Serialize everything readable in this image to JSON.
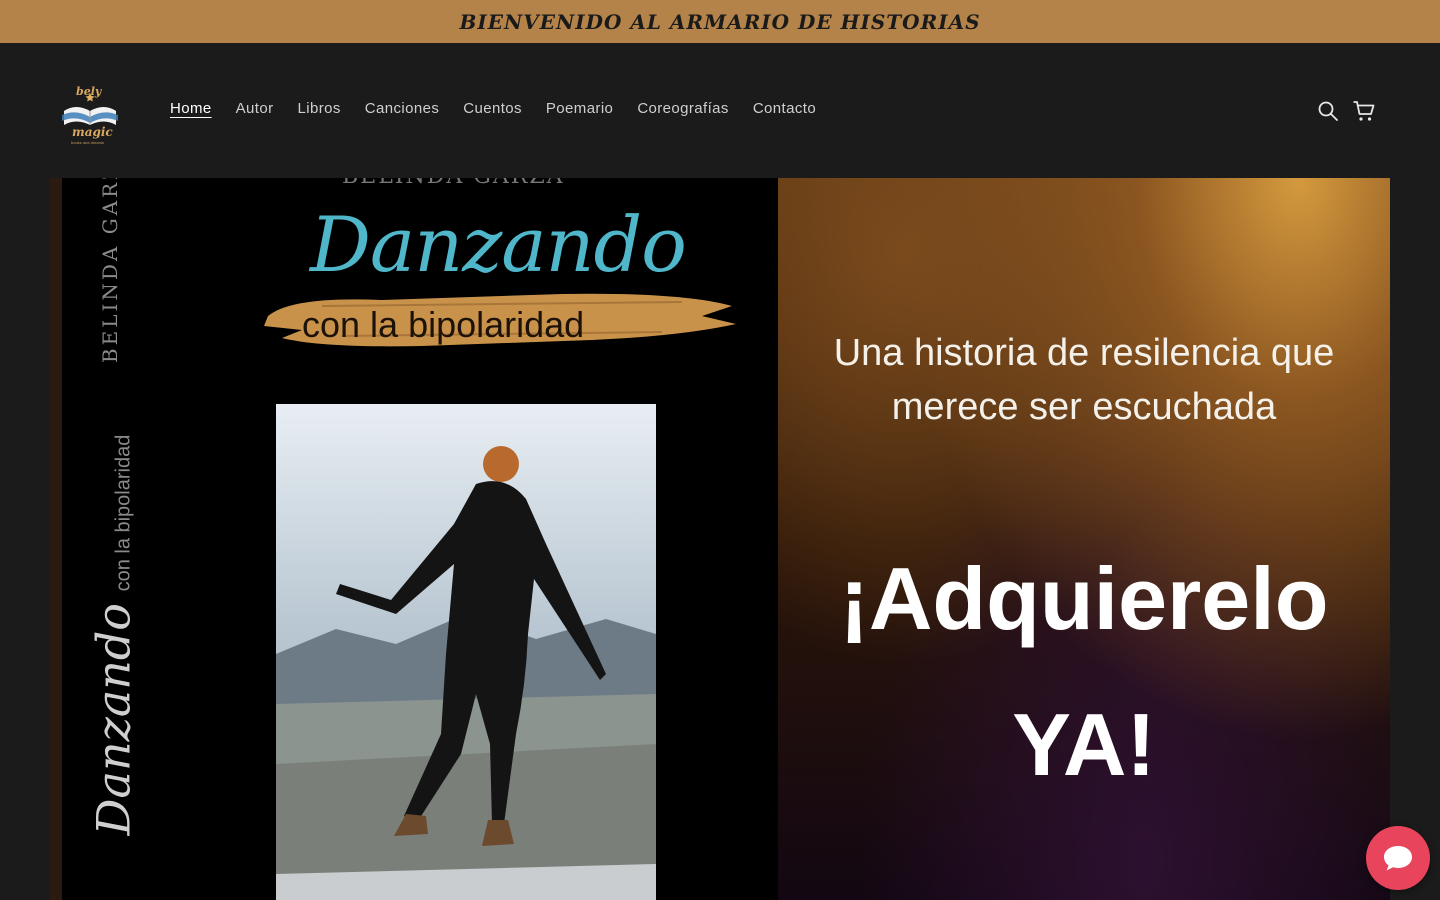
{
  "announcement": {
    "text": "BIENVENIDO AL ARMARIO DE HISTORIAS"
  },
  "header": {
    "logo": {
      "top_word": "bely",
      "bottom_word": "magic",
      "tagline": "books and dreams"
    },
    "nav": [
      {
        "label": "Home",
        "active": true
      },
      {
        "label": "Autor"
      },
      {
        "label": "Libros"
      },
      {
        "label": "Canciones"
      },
      {
        "label": "Cuentos"
      },
      {
        "label": "Poemario"
      },
      {
        "label": "Coreografías"
      },
      {
        "label": "Contacto"
      }
    ],
    "icons": [
      "search-icon",
      "cart-icon"
    ]
  },
  "banner": {
    "cover": {
      "author_top": "BELINDA GARZA",
      "spine_author": "BELINDA GARZ",
      "spine_title_script": "Danzando",
      "spine_title_rest": "con la bipolaridad",
      "title_script": "Danzando",
      "subtitle": "con la bipolaridad"
    },
    "promo": {
      "line1": "Una historia de resilencia que",
      "line2": "merece ser escuchada",
      "cta1": "¡Adquierelo",
      "cta2": "YA!"
    }
  },
  "colors": {
    "announcement_bg": "#b4834a",
    "page_bg": "#1b1b1b",
    "title_blue": "#4fb7c9",
    "brush_gold": "#c9924a",
    "chat_button": "#e8455c"
  },
  "chat": {
    "icon": "chat-bubble-icon"
  }
}
